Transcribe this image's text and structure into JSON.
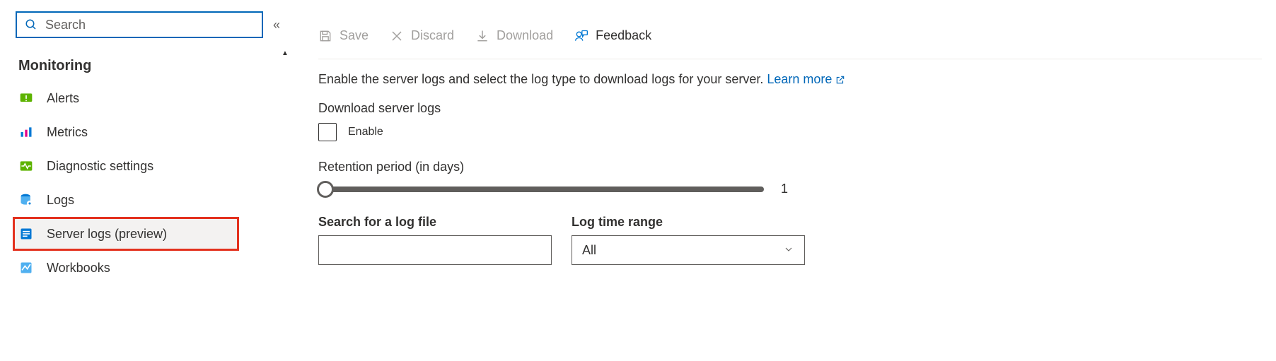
{
  "sidebar": {
    "search_placeholder": "Search",
    "section_title": "Monitoring",
    "items": [
      {
        "label": "Alerts"
      },
      {
        "label": "Metrics"
      },
      {
        "label": "Diagnostic settings"
      },
      {
        "label": "Logs"
      },
      {
        "label": "Server logs (preview)"
      },
      {
        "label": "Workbooks"
      }
    ]
  },
  "toolbar": {
    "save": "Save",
    "discard": "Discard",
    "download": "Download",
    "feedback": "Feedback"
  },
  "main": {
    "description": "Enable the server logs and select the log type to download logs for your server.",
    "learn_more": "Learn more",
    "download_label": "Download server logs",
    "enable_label": "Enable",
    "retention_label": "Retention period (in days)",
    "retention_value": "1",
    "search_label": "Search for a log file",
    "search_value": "",
    "timerange_label": "Log time range",
    "timerange_value": "All"
  }
}
